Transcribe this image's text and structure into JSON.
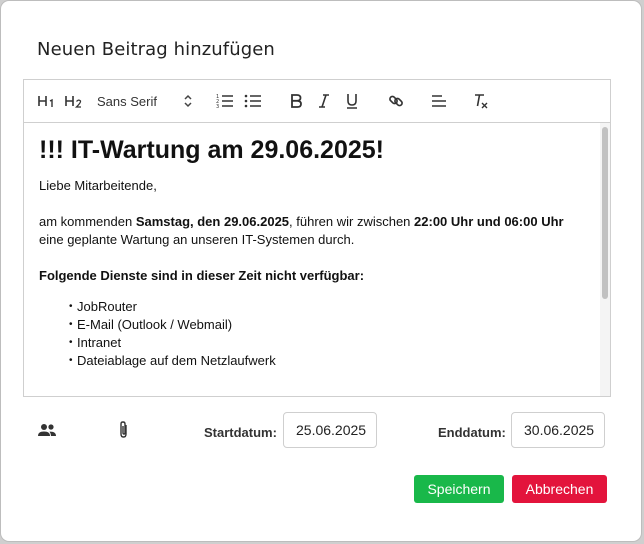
{
  "dialog": {
    "title": "Neuen Beitrag hinzufügen"
  },
  "toolbar": {
    "heading1_label": "H1",
    "heading2_label": "H2",
    "font_select": "Sans Serif",
    "icons": [
      "heading-1-icon",
      "heading-2-icon",
      "chevron-updown-icon",
      "ordered-list-icon",
      "bullet-list-icon",
      "bold-icon",
      "italic-icon",
      "underline-icon",
      "link-icon",
      "align-left-icon",
      "clear-format-icon"
    ]
  },
  "content": {
    "heading": "!!! IT-Wartung am 29.06.2025!",
    "greeting": "Liebe Mitarbeitende,",
    "para": {
      "t1": "am kommenden ",
      "b1": "Samstag, den 29.06.2025",
      "t2": ", führen wir zwischen ",
      "b2": "22:00 Uhr und 06:00 Uhr",
      "t3": " eine geplante Wartung an unseren IT-Systemen durch."
    },
    "services_heading": "Folgende Dienste sind in dieser Zeit nicht verfügbar:",
    "services": [
      "JobRouter",
      "E-Mail (Outlook / Webmail)",
      "Intranet",
      "Dateiablage auf dem Netzlaufwerk"
    ]
  },
  "footer": {
    "audience_icon": "people-icon",
    "attachment_icon": "paperclip-icon",
    "start_label": "Startdatum:",
    "start_value": "25.06.2025",
    "end_label": "Enddatum:",
    "end_value": "30.06.2025"
  },
  "actions": {
    "save_label": "Speichern",
    "cancel_label": "Abbrechen",
    "save_color": "#19b84a",
    "cancel_color": "#e3143c"
  }
}
